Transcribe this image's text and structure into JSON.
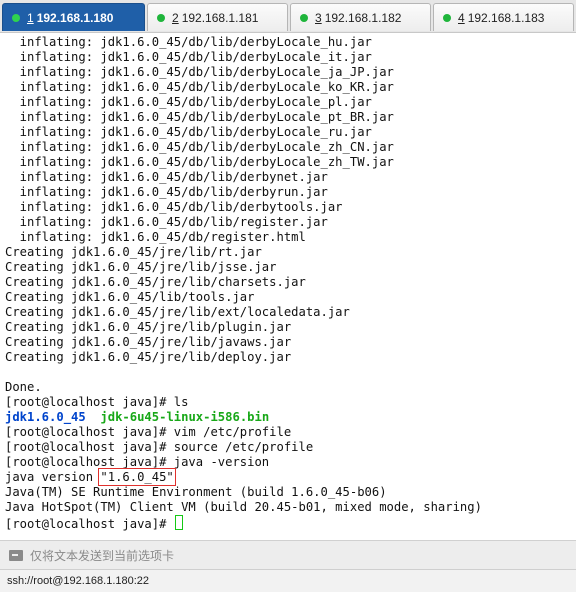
{
  "tabs": [
    {
      "num": "1",
      "title": "192.168.1.180",
      "active": true
    },
    {
      "num": "2",
      "title": "192.168.1.181",
      "active": false
    },
    {
      "num": "3",
      "title": "192.168.1.182",
      "active": false
    },
    {
      "num": "4",
      "title": "192.168.1.183",
      "active": false
    }
  ],
  "terminal": {
    "lines": [
      "  inflating: jdk1.6.0_45/db/lib/derbyLocale_hu.jar",
      "  inflating: jdk1.6.0_45/db/lib/derbyLocale_it.jar",
      "  inflating: jdk1.6.0_45/db/lib/derbyLocale_ja_JP.jar",
      "  inflating: jdk1.6.0_45/db/lib/derbyLocale_ko_KR.jar",
      "  inflating: jdk1.6.0_45/db/lib/derbyLocale_pl.jar",
      "  inflating: jdk1.6.0_45/db/lib/derbyLocale_pt_BR.jar",
      "  inflating: jdk1.6.0_45/db/lib/derbyLocale_ru.jar",
      "  inflating: jdk1.6.0_45/db/lib/derbyLocale_zh_CN.jar",
      "  inflating: jdk1.6.0_45/db/lib/derbyLocale_zh_TW.jar",
      "  inflating: jdk1.6.0_45/db/lib/derbynet.jar",
      "  inflating: jdk1.6.0_45/db/lib/derbyrun.jar",
      "  inflating: jdk1.6.0_45/db/lib/derbytools.jar",
      "  inflating: jdk1.6.0_45/db/lib/register.jar",
      "  inflating: jdk1.6.0_45/db/register.html",
      "Creating jdk1.6.0_45/jre/lib/rt.jar",
      "Creating jdk1.6.0_45/jre/lib/jsse.jar",
      "Creating jdk1.6.0_45/jre/lib/charsets.jar",
      "Creating jdk1.6.0_45/lib/tools.jar",
      "Creating jdk1.6.0_45/jre/lib/ext/localedata.jar",
      "Creating jdk1.6.0_45/jre/lib/plugin.jar",
      "Creating jdk1.6.0_45/jre/lib/javaws.jar",
      "Creating jdk1.6.0_45/jre/lib/deploy.jar",
      "",
      "Done.",
      "[root@localhost java]# ls"
    ],
    "ls_output": {
      "dir_name": "jdk1.6.0_45",
      "file_name": "jdk-6u45-linux-i586.bin"
    },
    "lines_after": [
      "[root@localhost java]# vim /etc/profile",
      "[root@localhost java]# source /etc/profile",
      "[root@localhost java]# java -version"
    ],
    "version_prefix": "java version ",
    "version_value": "\"1.6.0_45\"",
    "lines_end": [
      "Java(TM) SE Runtime Environment (build 1.6.0_45-b06)",
      "Java HotSpot(TM) Client VM (build 20.45-b01, mixed mode, sharing)"
    ],
    "prompt": "[root@localhost java]# "
  },
  "send_bar": {
    "placeholder": "仅将文本发送到当前选项卡",
    "icon": "send-icon"
  },
  "status_bar": {
    "text": "ssh://root@192.168.1.180:22"
  }
}
